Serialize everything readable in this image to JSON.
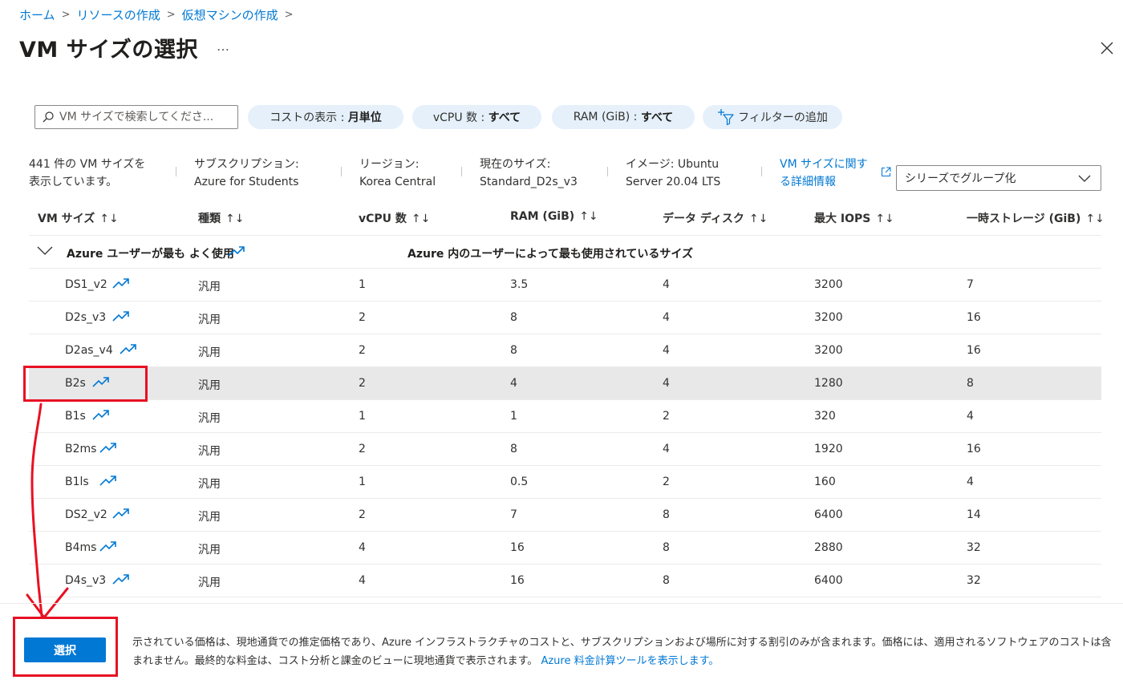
{
  "breadcrumb": [
    {
      "label": "ホーム"
    },
    {
      "label": "リソースの作成"
    },
    {
      "label": "仮想マシンの作成"
    }
  ],
  "title": "VM サイズの選択",
  "title_more": "…",
  "search": {
    "placeholder": "VM サイズで検索してくださ..."
  },
  "filters": {
    "cost": {
      "label": "コストの表示 : ",
      "value": "月単位"
    },
    "vcpu": {
      "label": "vCPU 数 : ",
      "value": "すべて"
    },
    "ram": {
      "label": "RAM (GiB) : ",
      "value": "すべて"
    },
    "add_filter": "フィルターの追加"
  },
  "info": {
    "count_line1": "441 件の VM サイズを",
    "count_line2": "表示しています。",
    "subscription_label": "サブスクリプション:",
    "subscription_value": "Azure for Students",
    "region_label": "リージョン:",
    "region_value": "Korea Central",
    "current_size_label": "現在のサイズ:",
    "current_size_value": "Standard_D2s_v3",
    "image_line1": "イメージ: Ubuntu",
    "image_line2": "Server 20.04 LTS",
    "details_link_line1": "VM サイズに関す",
    "details_link_line2": "る詳細情報",
    "group_by": "シリーズでグループ化"
  },
  "table": {
    "sort_glyph": "↑↓",
    "columns": [
      "VM サイズ",
      "種類",
      "vCPU 数",
      "RAM (GiB)",
      "データ ディスク",
      "最大 IOPS",
      "一時ストレージ (GiB)"
    ],
    "group": {
      "label": "Azure ユーザーが最も よく使用",
      "description": "Azure 内のユーザーによって最も使用されているサイズ"
    },
    "rows": [
      {
        "size": "DS1_v2",
        "type": "汎用",
        "vcpu": "1",
        "ram": "3.5",
        "disks": "4",
        "iops": "3200",
        "temp": "7"
      },
      {
        "size": "D2s_v3",
        "type": "汎用",
        "vcpu": "2",
        "ram": "8",
        "disks": "4",
        "iops": "3200",
        "temp": "16"
      },
      {
        "size": "D2as_v4",
        "type": "汎用",
        "vcpu": "2",
        "ram": "8",
        "disks": "4",
        "iops": "3200",
        "temp": "16"
      },
      {
        "size": "B2s",
        "type": "汎用",
        "vcpu": "2",
        "ram": "4",
        "disks": "4",
        "iops": "1280",
        "temp": "8"
      },
      {
        "size": "B1s",
        "type": "汎用",
        "vcpu": "1",
        "ram": "1",
        "disks": "2",
        "iops": "320",
        "temp": "4"
      },
      {
        "size": "B2ms",
        "type": "汎用",
        "vcpu": "2",
        "ram": "8",
        "disks": "4",
        "iops": "1920",
        "temp": "16"
      },
      {
        "size": "B1ls",
        "type": "汎用",
        "vcpu": "1",
        "ram": "0.5",
        "disks": "2",
        "iops": "160",
        "temp": "4"
      },
      {
        "size": "DS2_v2",
        "type": "汎用",
        "vcpu": "2",
        "ram": "7",
        "disks": "8",
        "iops": "6400",
        "temp": "14"
      },
      {
        "size": "B4ms",
        "type": "汎用",
        "vcpu": "4",
        "ram": "16",
        "disks": "8",
        "iops": "2880",
        "temp": "32"
      },
      {
        "size": "D4s_v3",
        "type": "汎用",
        "vcpu": "4",
        "ram": "16",
        "disks": "8",
        "iops": "6400",
        "temp": "32"
      }
    ],
    "selected_size": "B2s"
  },
  "footer": {
    "select_button": "選択",
    "text": "示されている価格は、現地通貨での推定価格であり、Azure インフラストラクチャのコストと、サブスクリプションおよび場所に対する割引のみが含まれます。価格には、適用されるソフトウェアのコストは含まれません。最終的な料金は、コスト分析と課金のビューに現地通貨で表示されます。",
    "link": "Azure 料金計算ツールを表示します。"
  },
  "colors": {
    "accent": "#0078d4",
    "annotation": "#e81123",
    "pill_bg": "#e5f0fa",
    "selected_row": "#e8e8e8"
  }
}
